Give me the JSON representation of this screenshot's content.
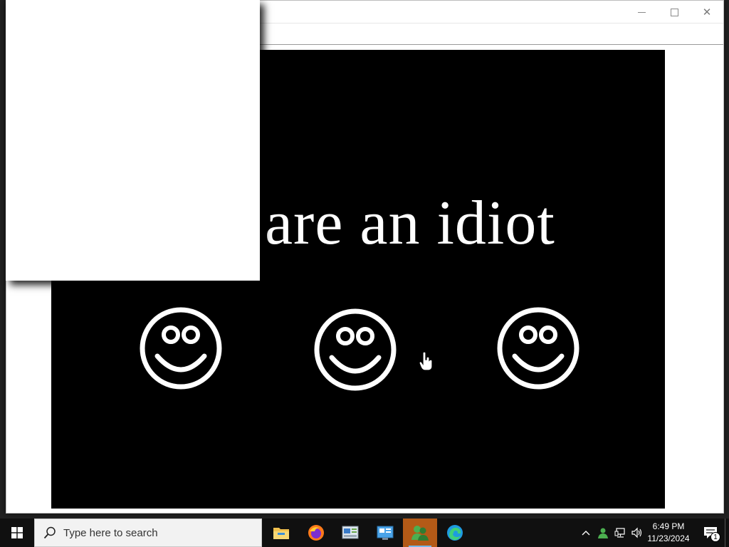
{
  "page": {
    "headline": "are an idiot"
  },
  "window_main": {
    "minimize_glyph": "minimize",
    "maximize_glyph": "maximize",
    "close_glyph": "✕"
  },
  "taskbar": {
    "search_placeholder": "Type here to search",
    "apps": [
      {
        "name": "file-explorer-icon"
      },
      {
        "name": "firefox-icon"
      },
      {
        "name": "control-panel-icon"
      },
      {
        "name": "system-info-icon"
      },
      {
        "name": "users-icon",
        "active": true
      },
      {
        "name": "edge-icon"
      }
    ],
    "clock": {
      "time": "6:49 PM",
      "date": "11/23/2024"
    },
    "notification_count": "1"
  },
  "colors": {
    "stage": "#000000",
    "smiley": "#ffffff",
    "active_taskbar_app": "#b35a17",
    "taskbar": "#101010"
  }
}
